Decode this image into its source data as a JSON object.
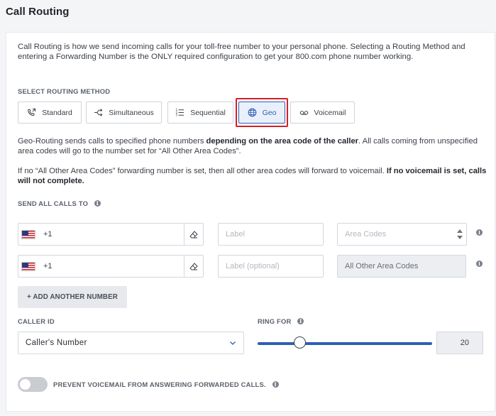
{
  "page": {
    "title": "Call Routing"
  },
  "intro": "Call Routing is how we send incoming calls for your toll-free number to your personal phone. Selecting a Routing Method and entering a Forwarding Number is the ONLY required configuration to get your 800.com phone number working.",
  "routing": {
    "label": "SELECT ROUTING METHOD",
    "selected": "Geo",
    "methods": [
      {
        "label": "Standard",
        "icon": "phone-forward-icon"
      },
      {
        "label": "Simultaneous",
        "icon": "split-arrows-icon"
      },
      {
        "label": "Sequential",
        "icon": "numbered-list-icon"
      },
      {
        "label": "Geo",
        "icon": "globe-icon"
      },
      {
        "label": "Voicemail",
        "icon": "voicemail-icon"
      }
    ]
  },
  "geo_desc": {
    "p1_a": "Geo-Routing sends calls to specified phone numbers ",
    "p1_b": "depending on the area code of the caller",
    "p1_c": ". All calls coming from unspecified area codes will go to the number set for “All Other Area Codes”.",
    "p2_a": "If no “All Other Area Codes” forwarding number is set, then all other area codes will forward to voicemail. ",
    "p2_b": "If no voicemail is set, calls will not complete."
  },
  "send_to": {
    "label": "SEND ALL CALLS TO",
    "rows": [
      {
        "country_code": "+1",
        "label_placeholder": "Label",
        "area_placeholder": "Area Codes",
        "area_value": ""
      },
      {
        "country_code": "+1",
        "label_placeholder": "Label (optional)",
        "area_placeholder": "",
        "area_value": "All Other Area Codes"
      }
    ],
    "add_button": "+ ADD ANOTHER NUMBER"
  },
  "caller_id": {
    "label": "CALLER ID",
    "value": "Caller's Number"
  },
  "ring_for": {
    "label": "RING FOR",
    "value": "20",
    "slider_fraction": 0.24
  },
  "prevent_voicemail": {
    "label": "PREVENT VOICEMAIL FROM ANSWERING FORWARDED CALLS.",
    "enabled": false
  },
  "colors": {
    "accent": "#2f5fb3",
    "highlight": "#d3202a"
  }
}
